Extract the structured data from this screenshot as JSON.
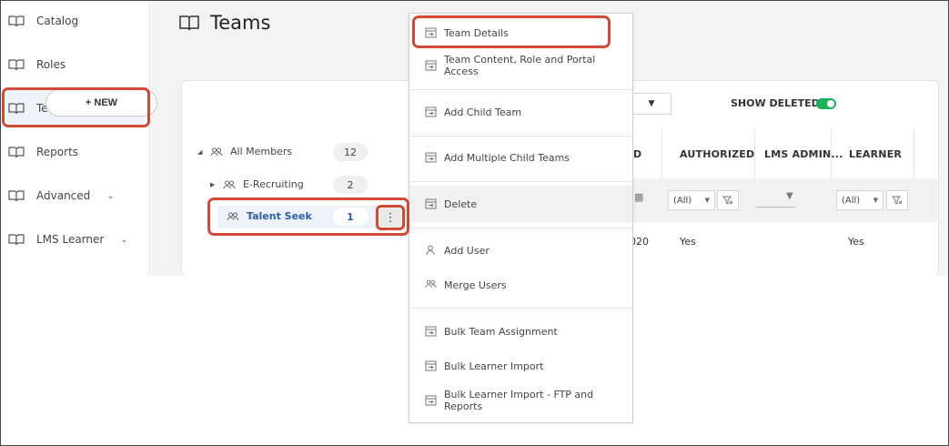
{
  "sidebar": {
    "items": [
      {
        "label": "Catalog",
        "icon": "book-icon",
        "expandable": false
      },
      {
        "label": "Roles",
        "icon": "book-icon",
        "expandable": false
      },
      {
        "label": "Teams",
        "icon": "book-icon",
        "expandable": false,
        "active": true
      },
      {
        "label": "Reports",
        "icon": "book-icon",
        "expandable": false
      },
      {
        "label": "Advanced",
        "icon": "book-icon",
        "expandable": true
      },
      {
        "label": "LMS Learner",
        "icon": "book-icon",
        "expandable": true
      }
    ],
    "chevron": "⌄"
  },
  "page": {
    "title": "Teams"
  },
  "toolbar": {
    "new_label": "+ NEW",
    "show_deleted_label": "SHOW DELETED:",
    "show_deleted_on": true
  },
  "tree": {
    "root": {
      "label": "All Members",
      "count": "12",
      "caret": "◢"
    },
    "child": {
      "label": "E-Recruiting",
      "count": "2",
      "caret": "▶"
    },
    "selected": {
      "label": "Talent Seek",
      "count": "1"
    },
    "kebab": "⋮"
  },
  "table": {
    "partial_header": "D",
    "headers": [
      "AUTHORIZED",
      "LMS ADMIN...",
      "LEARNER"
    ],
    "filter_all": "(All)",
    "row": {
      "partial_date": "020",
      "authorized": "Yes",
      "learner": "Yes"
    }
  },
  "context_menu": {
    "items": [
      {
        "label": "Team Details",
        "icon": "link-box-icon"
      },
      {
        "label": "Team Content, Role and Portal Access",
        "icon": "link-box-icon"
      },
      {
        "label": "Add Child Team",
        "icon": "link-box-icon"
      },
      {
        "label": "Add Multiple Child Teams",
        "icon": "link-box-icon"
      },
      {
        "label": "Delete",
        "icon": "link-box-icon"
      },
      {
        "label": "Add User",
        "icon": "user-icon"
      },
      {
        "label": "Merge Users",
        "icon": "users-icon"
      },
      {
        "label": "Bulk Team Assignment",
        "icon": "link-box-icon"
      },
      {
        "label": "Bulk Learner Import",
        "icon": "link-box-icon"
      },
      {
        "label": "Bulk Learner Import - FTP and Reports",
        "icon": "link-box-icon"
      }
    ]
  },
  "colors": {
    "highlight": "#d04a36",
    "toggle": "#19b35a",
    "link": "#2a5db0"
  }
}
